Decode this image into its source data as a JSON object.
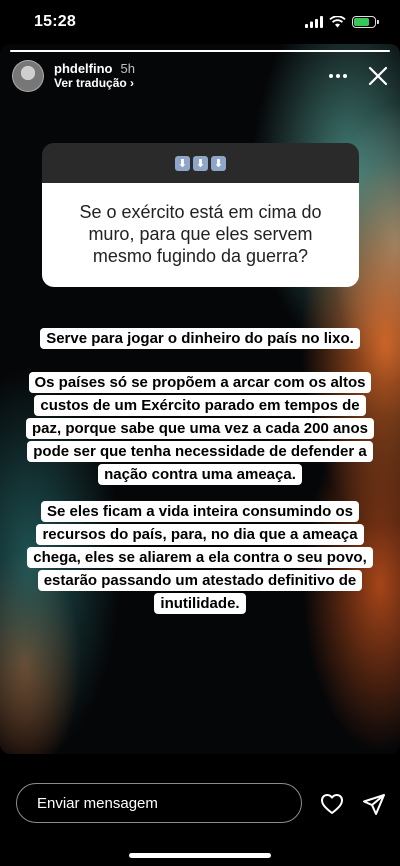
{
  "status_bar": {
    "time": "15:28",
    "battery_level": 0.7,
    "battery_color": "#35c759"
  },
  "story": {
    "progress": 1.0,
    "username": "phdelfino",
    "age": "5h",
    "translate_label": "Ver tradução",
    "translate_chevron": "›",
    "more_icon": "more-dots-icon",
    "close_icon": "close-icon"
  },
  "question_card": {
    "emojis": [
      "⬇",
      "⬇",
      "⬇"
    ],
    "text": "Se o exército está em cima do muro, para que eles servem mesmo fugindo da guerra?"
  },
  "answers": [
    "Serve para jogar o dinheiro do país no lixo.",
    "Os países só se propõem a arcar com os altos custos de um Exército parado em tempos de paz, porque sabe que uma vez a cada 200 anos pode ser que tenha necessidade de defender a nação contra uma ameaça.",
    "Se eles ficam a vida inteira consumindo os recursos do país, para, no dia que a ameaça chega, eles se aliarem a ela contra o seu povo, estarão passando um atestado definitivo de inutilidade."
  ],
  "bottom_bar": {
    "message_placeholder": "Enviar mensagem",
    "like_icon": "heart-icon",
    "send_icon": "send-icon"
  }
}
